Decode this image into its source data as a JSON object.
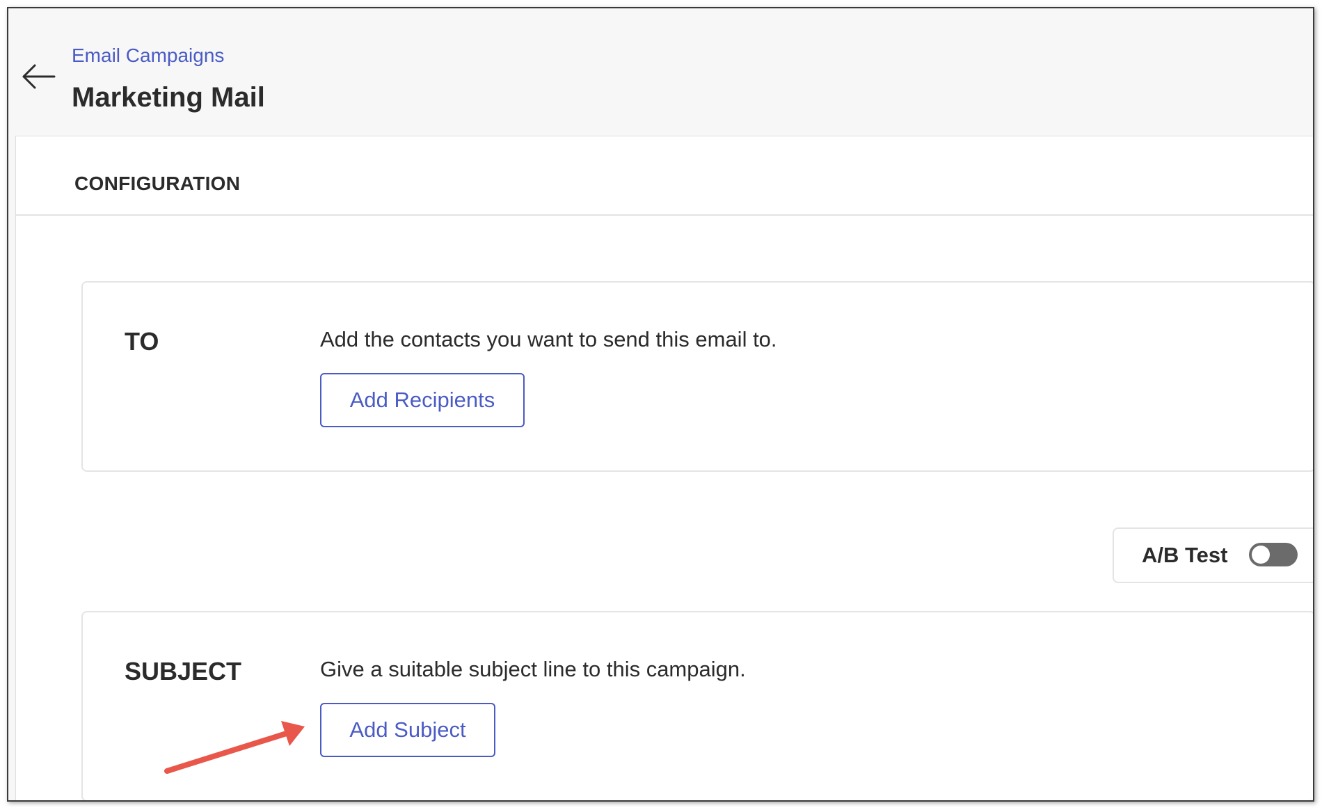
{
  "header": {
    "breadcrumb": "Email Campaigns",
    "title": "Marketing Mail",
    "back_icon": "arrow-left-icon"
  },
  "configuration": {
    "heading": "CONFIGURATION",
    "to": {
      "label": "TO",
      "description": "Add the contacts you want to send this email to.",
      "button_label": "Add Recipients"
    },
    "ab_test": {
      "label": "A/B Test",
      "enabled": false
    },
    "subject": {
      "label": "SUBJECT",
      "description": "Give a suitable subject line to this campaign.",
      "button_label": "Add Subject"
    }
  },
  "annotation": {
    "icon": "callout-arrow-icon",
    "color": "#e8574a"
  },
  "colors": {
    "accent": "#4a5bc4",
    "text": "#2b2b2b",
    "header_bg": "#f7f7f7",
    "toggle_off": "#6b6b6b"
  }
}
